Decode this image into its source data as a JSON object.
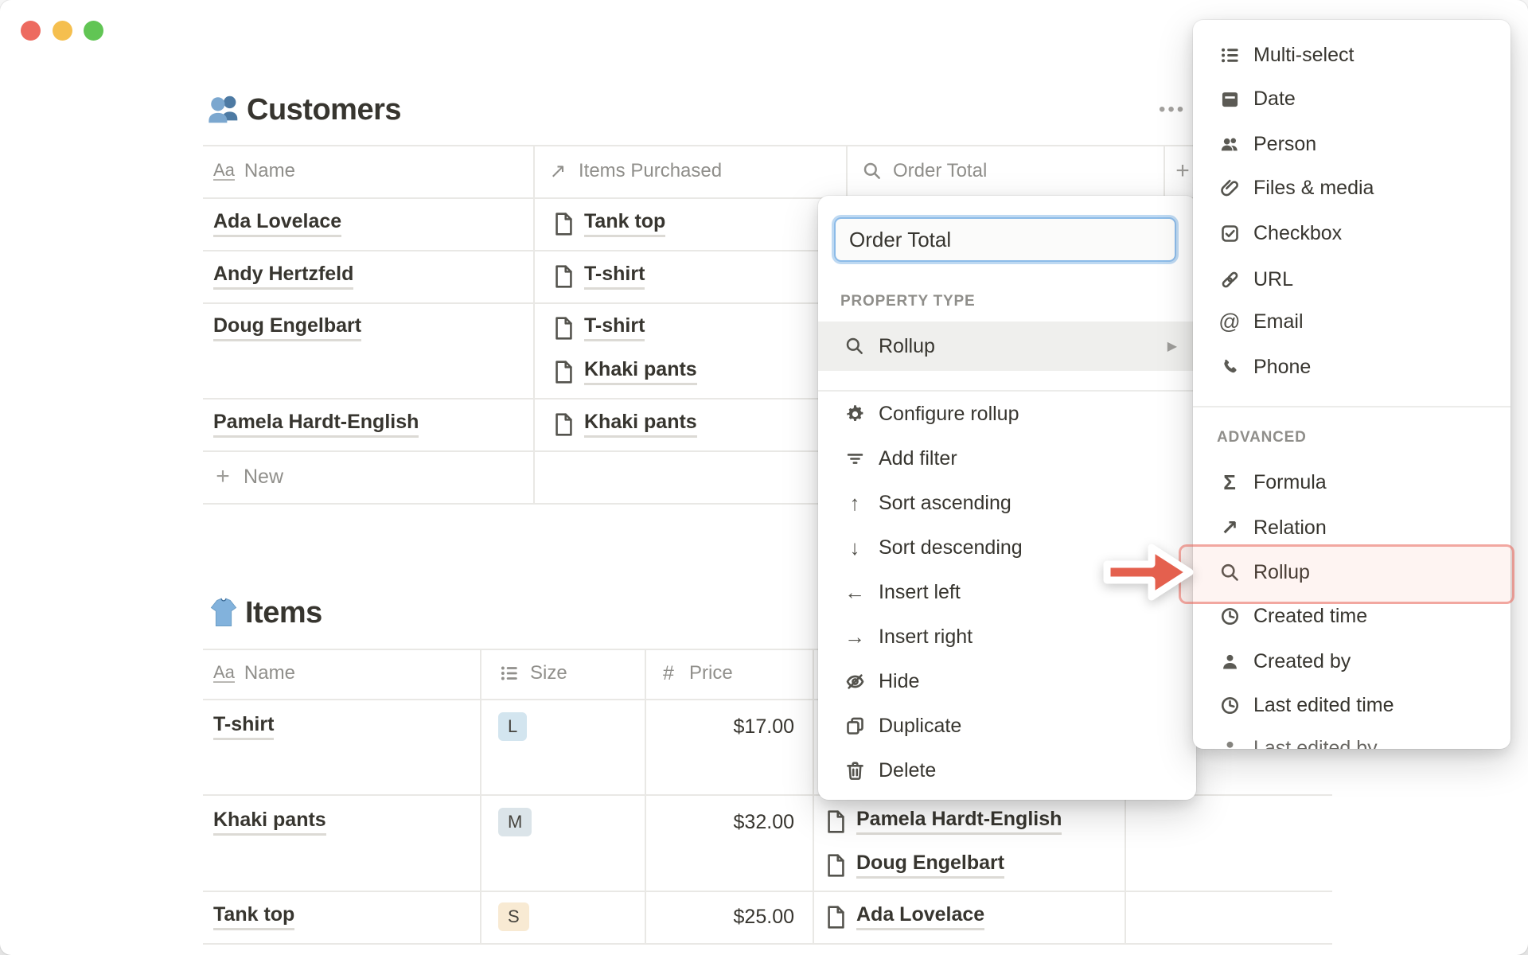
{
  "window": {
    "traffic_lights": {
      "close": "#ed6a5f",
      "minimize": "#f5bf4f",
      "zoom": "#61c554"
    }
  },
  "customers": {
    "title": "Customers",
    "more_glyph": "•••",
    "headers": [
      {
        "icon": "text-icon",
        "label": "Name"
      },
      {
        "icon": "relation-icon",
        "label": "Items Purchased"
      },
      {
        "icon": "rollup-icon",
        "label": "Order Total"
      }
    ],
    "add_property_glyph": "+",
    "rows": [
      {
        "name": "Ada Lovelace",
        "items": [
          "Tank top"
        ]
      },
      {
        "name": "Andy Hertzfeld",
        "items": [
          "T-shirt"
        ]
      },
      {
        "name": "Doug Engelbart",
        "items": [
          "T-shirt",
          "Khaki pants"
        ]
      },
      {
        "name": "Pamela Hardt-English",
        "items": [
          "Khaki pants"
        ]
      }
    ],
    "new_row": "New",
    "new_glyph": "+"
  },
  "items": {
    "title": "Items",
    "headers": [
      {
        "icon": "text-icon",
        "label": "Name"
      },
      {
        "icon": "select-icon",
        "label": "Size"
      },
      {
        "icon": "number-icon",
        "label": "Price"
      }
    ],
    "rows": [
      {
        "name": "T-shirt",
        "size": "L",
        "size_color": "#d3e5ef",
        "price": "$17.00",
        "purchasers": []
      },
      {
        "name": "Khaki pants",
        "size": "M",
        "size_color": "#dbe4e9",
        "price": "$32.00",
        "purchasers": [
          "Pamela Hardt-English",
          "Doug Engelbart"
        ]
      },
      {
        "name": "Tank top",
        "size": "S",
        "size_color": "#f8ead3",
        "price": "$25.00",
        "purchasers": [
          "Ada Lovelace"
        ]
      }
    ]
  },
  "property_menu": {
    "name_value": "Order Total",
    "section_label": "PROPERTY TYPE",
    "current_type": "Rollup",
    "submenu_glyph": "▶",
    "actions": [
      "Configure rollup",
      "Add filter",
      "Sort ascending",
      "Sort descending",
      "Insert left",
      "Insert right",
      "Hide",
      "Duplicate",
      "Delete"
    ]
  },
  "type_menu": {
    "basic": [
      "Multi-select",
      "Date",
      "Person",
      "Files & media",
      "Checkbox",
      "URL",
      "Email",
      "Phone"
    ],
    "advanced_label": "ADVANCED",
    "advanced": [
      "Formula",
      "Relation",
      "Rollup",
      "Created time",
      "Created by",
      "Last edited time",
      "Last edited by"
    ],
    "highlighted": "Rollup"
  },
  "glyphs": {
    "text": "Aa",
    "relation": "↗",
    "number": "#",
    "email": "@",
    "formula": "Σ",
    "arrow_up": "↑",
    "arrow_down": "↓",
    "arrow_left": "←",
    "arrow_right": "→"
  },
  "colors": {
    "accent_blue": "#2383e2",
    "annotation_red": "#e4604e",
    "highlight_border": "#ea685c",
    "highlight_fill": "#fdf1ef",
    "table_line": "#e9e8e5",
    "text": "#37352f",
    "muted": "#8f8e8b",
    "tag_blue": "#d3e5ef",
    "tag_bluegrey": "#dbe4e9",
    "tag_peach": "#f8ead3"
  }
}
